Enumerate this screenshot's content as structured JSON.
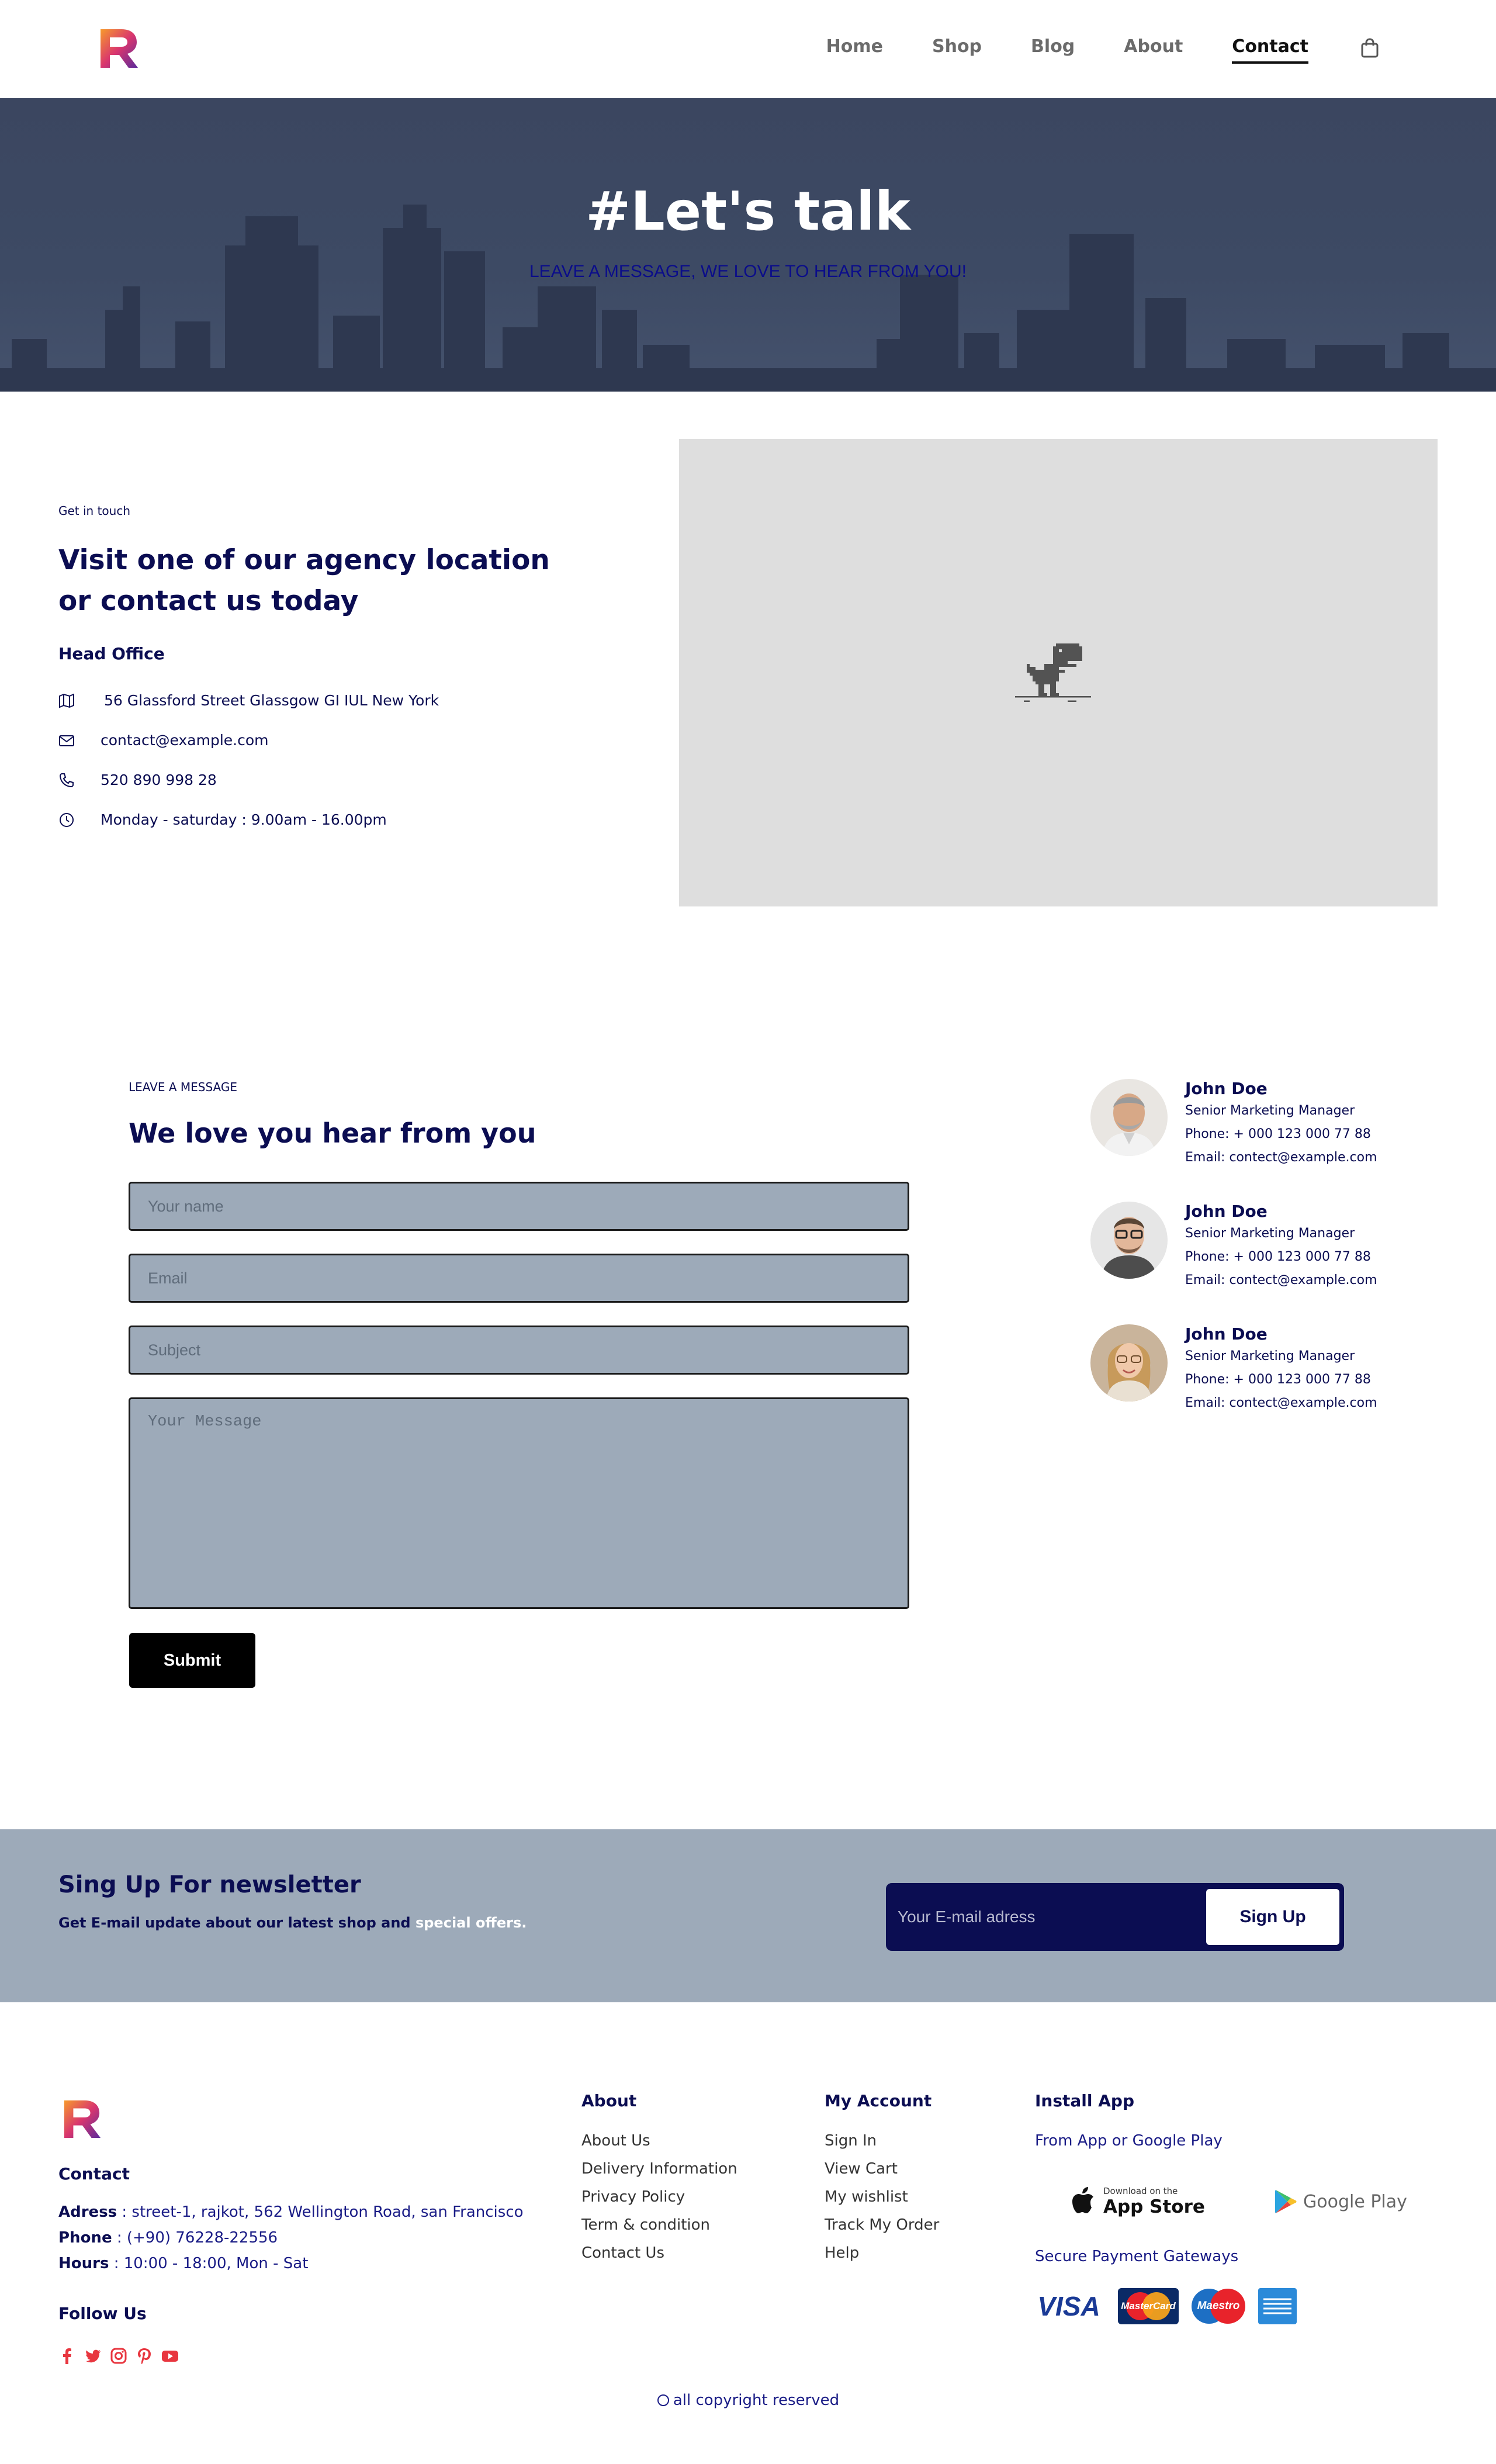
{
  "nav": {
    "links": [
      "Home",
      "Shop",
      "Blog",
      "About",
      "Contact"
    ],
    "active": "Contact",
    "cart_icon": "shopping-bag-icon"
  },
  "hero": {
    "title": "#Let's talk",
    "subtitle": "LEAVE A MESSAGE, WE LOVE TO HEAR FROM YOU!"
  },
  "contact": {
    "eyebrow": "Get in touch",
    "heading": "Visit one of our agency location or contact us today",
    "office_title": "Head Office",
    "address": "56 Glassford Street Glassgow GI IUL New York",
    "email": "contact@example.com",
    "phone": "520 890 998 28",
    "hours": "Monday - saturday : 9.00am - 16.00pm"
  },
  "form": {
    "eyebrow": "LEAVE A MESSAGE",
    "heading": "We love you hear from you",
    "name_placeholder": "Your name",
    "email_placeholder": "Email",
    "subject_placeholder": "Subject",
    "message_placeholder": "Your Message",
    "submit_label": "Submit"
  },
  "people": [
    {
      "name": "John Doe",
      "role": "Senior Marketing Manager",
      "phone": "Phone: + 000 123 000 77 88",
      "email": "Email: contect@example.com"
    },
    {
      "name": "John Doe",
      "role": "Senior Marketing Manager",
      "phone": "Phone: + 000 123 000 77 88",
      "email": "Email: contect@example.com"
    },
    {
      "name": "John Doe",
      "role": "Senior Marketing Manager",
      "phone": "Phone: + 000 123 000 77 88",
      "email": "Email: contect@example.com"
    }
  ],
  "newsletter": {
    "title": "Sing Up For newsletter",
    "sub_text": "Get E-mail update about our latest shop and",
    "sub_highlight": "special offers.",
    "input_placeholder": "Your E-mail adress",
    "button_label": "Sign Up"
  },
  "footer": {
    "contact_title": "Contact",
    "address_label": "Adress",
    "address": ": street-1, rajkot, 562 Wellington Road, san Francisco",
    "phone_label": "Phone",
    "phone": ": (+90) 76228-22556",
    "hours_label": "Hours",
    "hours": ": 10:00 - 18:00, Mon - Sat",
    "follow_title": "Follow Us",
    "about_title": "About",
    "about_links": [
      "About Us",
      "Delivery Information",
      "Privacy Policy",
      "Term & condition",
      "Contact Us"
    ],
    "account_title": "My Account",
    "account_links": [
      "Sign In",
      "View Cart",
      "My wishlist",
      "Track My Order",
      "Help"
    ],
    "install_title": "Install App",
    "install_sub": "From App or Google Play",
    "app_store_small": "Download on the",
    "app_store": "App Store",
    "google_play": "Google Play",
    "payment_title": "Secure Payment Gateways",
    "visa": "VISA",
    "mastercard": "MasterCard",
    "maestro": "Maestro",
    "copyright": "all copyright reserved"
  },
  "colors": {
    "navy": "#0b0d52",
    "hero_bg": "#3d4a64",
    "form_field": "#9daab9",
    "newsletter_bg": "#9daab9",
    "social": "#e8363f"
  }
}
